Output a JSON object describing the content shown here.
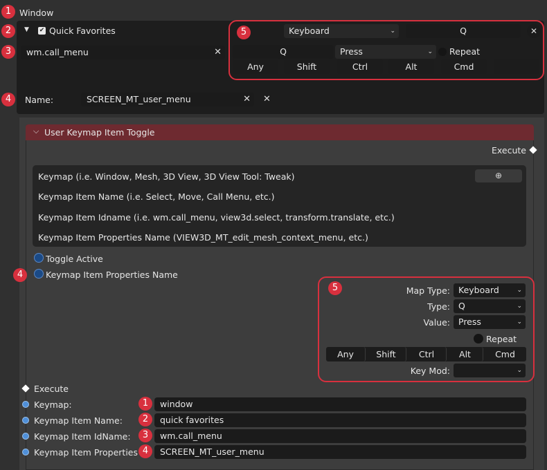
{
  "badges": {
    "one": "1",
    "two": "2",
    "three": "3",
    "four": "4",
    "five": "5"
  },
  "top": {
    "window_label": "Window",
    "quick_favorites": {
      "expand_glyph": "▼",
      "label": "Quick Favorites",
      "checked": true
    },
    "operator_value": "wm.call_menu",
    "name_label": "Name:",
    "name_value": "SCREEN_MT_user_menu",
    "keymap": {
      "map_type": "Keyboard",
      "key": "Q",
      "key2": "Q",
      "value": "Press",
      "repeat_label": "Repeat",
      "modifiers": [
        "Any",
        "Shift",
        "Ctrl",
        "Alt",
        "Cmd"
      ],
      "empty_key": ""
    }
  },
  "node": {
    "header_title": "User Keymap Item Toggle",
    "execute_out": "Execute",
    "description_lines": [
      "Keymap (i.e. Window, Mesh, 3D View, 3D View Tool: Tweak)",
      "Keymap Item Name (i.e. Select, Move, Call Menu, etc.)",
      "Keymap Item Idname (i.e. wm.call_menu, view3d.select, transform.translate, etc.)",
      "Keymap Item Properties Name (VIEW3D_MT_edit_mesh_context_menu, etc.)"
    ],
    "toggle_active": "Toggle Active",
    "props_name_socket": "Keymap Item Properties Name",
    "keymap_settings": {
      "map_type_label": "Map Type:",
      "map_type_value": "Keyboard",
      "type_label": "Type:",
      "type_value": "Q",
      "value_label": "Value:",
      "value_value": "Press",
      "repeat_label": "Repeat",
      "modifiers": [
        "Any",
        "Shift",
        "Ctrl",
        "Alt",
        "Cmd"
      ],
      "key_mod_label": "Key Mod:",
      "key_mod_value": ""
    },
    "execute_in": "Execute",
    "inputs": [
      {
        "label": "Keymap:",
        "value": "window"
      },
      {
        "label": "Keymap Item Name:",
        "value": "quick favorites"
      },
      {
        "label": "Keymap Item IdName:",
        "value": "wm.call_menu"
      },
      {
        "label": "Keymap Item Properties N",
        "value": "SCREEN_MT_user_menu"
      }
    ]
  },
  "icons": {
    "close": "✕",
    "chevron": "⌄",
    "collapse": "⌵",
    "checkbox": "✔",
    "globe": "🌐"
  },
  "colors": {
    "accent_red": "#d8303e",
    "socket_blue": "#4f8fd8",
    "header_red": "#6e2a30"
  }
}
